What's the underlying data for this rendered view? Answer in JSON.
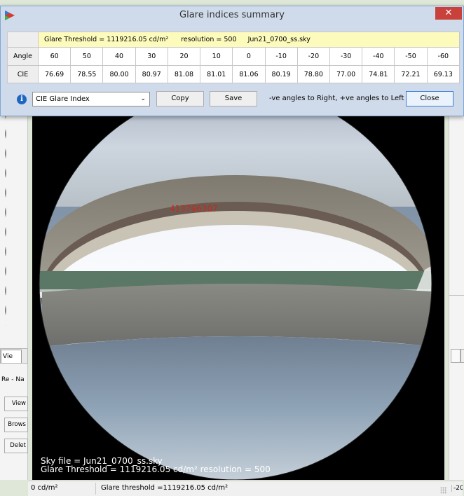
{
  "dialog": {
    "title": "Glare indices summary",
    "close_glyph": "✕"
  },
  "table": {
    "info": {
      "threshold": "Glare Threshold = 1119216.05 cd/m²",
      "resolution": "resolution = 500",
      "sky": "Jun21_0700_ss.sky"
    },
    "angle_label": "Angle",
    "cie_label": "CIE",
    "angles": [
      "60",
      "50",
      "40",
      "30",
      "20",
      "10",
      "0",
      "-10",
      "-20",
      "-30",
      "-40",
      "-50",
      "-60"
    ],
    "cie": [
      "76.69",
      "78.55",
      "80.00",
      "80.97",
      "81.08",
      "81.01",
      "81.06",
      "80.19",
      "78.80",
      "77.00",
      "74.81",
      "72.21",
      "69.13"
    ]
  },
  "controls": {
    "info_glyph": "i",
    "select_value": "CIE Glare Index",
    "copy_label": "Copy",
    "save_label": "Save",
    "hint": "-ve angles to Right, +ve angles to Left",
    "close_label": "Close"
  },
  "viewport": {
    "glare_value": "41379̶6307",
    "sky_file": "Sky file = Jun21_0700_ss.sky",
    "glare_line": "Glare Threshold = 1119216.05 cd/m² resolution = 500"
  },
  "status": {
    "left": "0 cd/m²",
    "right": "Glare threshold =1119216.05 cd/m²",
    "edge": "-20"
  },
  "background": {
    "tab_label": "Vie",
    "side_label": "Re - Na",
    "side_buttons": [
      "View",
      "Brows",
      "Delet"
    ]
  },
  "colors": {
    "dialog_bg": "#cfdaea",
    "info_row": "#fdfbbc",
    "close_red": "#c8413a",
    "glare_text": "#c8281e"
  }
}
